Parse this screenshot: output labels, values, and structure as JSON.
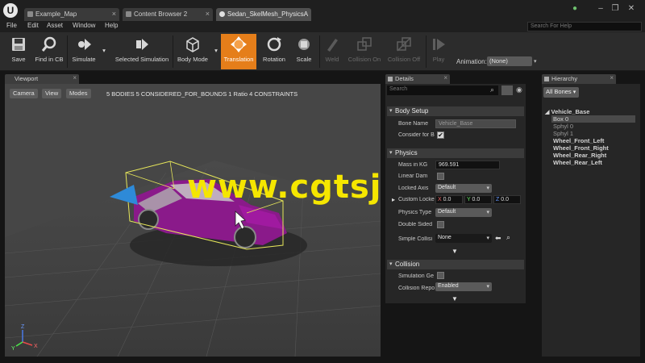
{
  "window": {
    "logo": "U",
    "tabs": [
      {
        "label": "Example_Map"
      },
      {
        "label": "Content Browser 2"
      },
      {
        "label": "Sedan_SkelMesh_PhysicsA"
      }
    ],
    "controls": {
      "minimize": "–",
      "restore": "❐",
      "close": "✕"
    }
  },
  "menu": {
    "items": [
      "File",
      "Edit",
      "Asset",
      "Window",
      "Help"
    ],
    "search_placeholder": "Search For Help"
  },
  "toolbar": {
    "buttons": [
      {
        "label": "Save",
        "icon": "save-icon"
      },
      {
        "label": "Find in CB",
        "icon": "find-icon"
      },
      {
        "label": "Simulate",
        "icon": "simulate-icon"
      },
      {
        "label": "Selected Simulation",
        "icon": "selected-simulation-icon"
      },
      {
        "label": "Body Mode",
        "icon": "body-mode-icon"
      },
      {
        "label": "Translation",
        "icon": "translation-icon"
      },
      {
        "label": "Rotation",
        "icon": "rotation-icon"
      },
      {
        "label": "Scale",
        "icon": "scale-icon"
      },
      {
        "label": "Weld",
        "icon": "weld-icon"
      },
      {
        "label": "Collision On",
        "icon": "collision-on-icon"
      },
      {
        "label": "Collision Off",
        "icon": "collision-off-icon"
      },
      {
        "label": "Play",
        "icon": "play-icon"
      }
    ],
    "animation_label": "Animation:",
    "animation_value": "(None)",
    "active_color": "#e57e1a"
  },
  "viewport": {
    "tab_label": "Viewport",
    "buttons": [
      "Camera",
      "View",
      "Modes"
    ],
    "stats": "5 BODIES  5 CONSIDERED_FOR_BOUNDS  1 Ratio  4 CONSTRAINTS",
    "watermark": "www.cgtsj.com",
    "car_color": "#8a1a8a",
    "axis_labels": {
      "x": "X",
      "y": "Y",
      "z": "Z"
    }
  },
  "details": {
    "tab_label": "Details",
    "search_placeholder": "Search",
    "body_setup": {
      "header": "Body Setup",
      "bone_name_label": "Bone Name",
      "bone_name_value": "Vehicle_Base",
      "consider_bounds_label": "Consider for B"
    },
    "physics": {
      "header": "Physics",
      "mass_label": "Mass in KG",
      "mass_value": "969.591",
      "linear_damping_label": "Linear Dam",
      "locked_axis_label": "Locked Axis",
      "locked_axis_value": "Default",
      "custom_locked_label": "Custom Locke",
      "custom_locked_x": "0.0",
      "custom_locked_y": "0.0",
      "custom_locked_z": "0.0",
      "physics_type_label": "Physics Type",
      "physics_type_value": "Default",
      "double_sided_label": "Double Sided",
      "simple_collision_label": "Simple Collisi",
      "simple_collision_value": "None"
    },
    "collision": {
      "header": "Collision",
      "sim_gen_label": "Simulation Ge",
      "collision_resp_label": "Collision Repo",
      "collision_resp_value": "Enabled"
    }
  },
  "hierarchy": {
    "tab_label": "Hierarchy",
    "filter": "All Bones",
    "items": [
      {
        "label": "Vehicle_Base"
      },
      {
        "label": "Box 0"
      },
      {
        "label": "Sphyl 0"
      },
      {
        "label": "Sphyl 1"
      },
      {
        "label": "Wheel_Front_Left"
      },
      {
        "label": "Wheel_Front_Right"
      },
      {
        "label": "Wheel_Rear_Right"
      },
      {
        "label": "Wheel_Rear_Left"
      }
    ]
  }
}
